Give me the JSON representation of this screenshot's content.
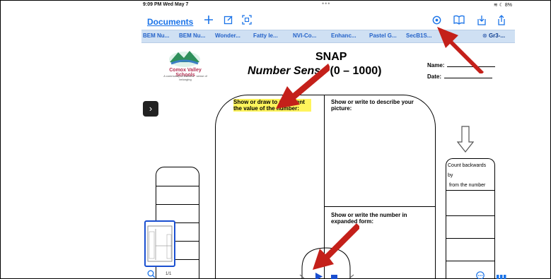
{
  "status_bar": {
    "time": "9:09 PM  Wed May 7",
    "dots": "•••",
    "battery": "≋ ☾ 8%"
  },
  "toolbar": {
    "documents_label": "Documents",
    "add_icon": "plus-icon",
    "edit_icon": "compose-icon",
    "scan_icon": "scan-icon",
    "settings_icon": "gear-icon",
    "book_icon": "book-icon",
    "download_icon": "download-icon",
    "share_icon": "share-icon"
  },
  "tabs": [
    "BEM Nu...",
    "BEM Nu...",
    "Wonder...",
    "Fatty le...",
    "NVI-Co...",
    "Enhanc...",
    "Pastel G...",
    "SecB1S...",
    "Gr3-..."
  ],
  "worksheet": {
    "logo_name": "Comox Valley Schools",
    "logo_sub": "A community of learners · sense of belonging",
    "title_line1": "SNAP",
    "title_line2_italic": "Number Sense",
    "title_line2_rest": "(0 – 1000)",
    "name_label": "Name:",
    "date_label": "Date:",
    "box1_label": "Show or draw to represent the value of the number:",
    "box2_label": "Show or write to describe your picture:",
    "box3_label": "Show or write the number in expanded  form:",
    "right_col_line1": "Count backwards",
    "right_col_line2": "by",
    "right_col_line3": "from the number"
  },
  "bottom_bar": {
    "page_count": "1/1"
  },
  "annotation_color": "#c4201a"
}
